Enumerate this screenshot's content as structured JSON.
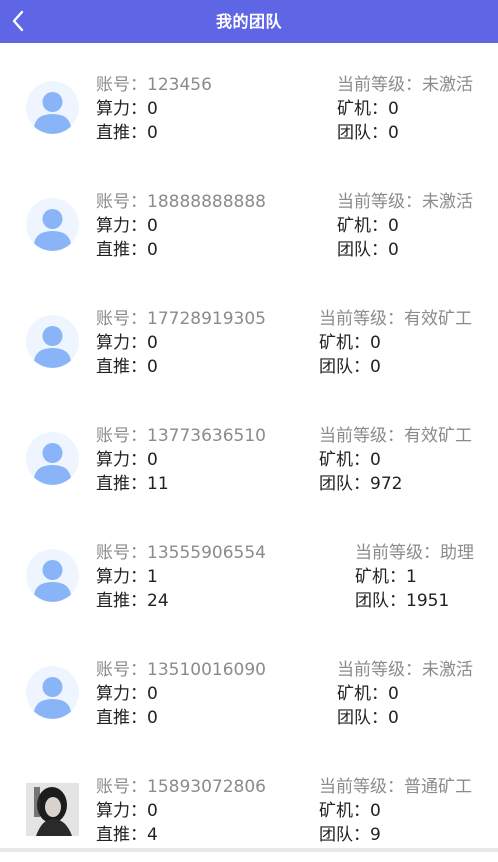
{
  "header": {
    "title": "我的团队",
    "back_icon": "chevron-left-icon",
    "background": "#5f66e6"
  },
  "labels": {
    "account": "账号：",
    "power": "算力：",
    "direct": "直推：",
    "level": "当前等级：",
    "miner": "矿机：",
    "team": "团队："
  },
  "members": [
    {
      "account": "123456",
      "power": "0",
      "direct": "0",
      "level": "未激活",
      "miner": "0",
      "team": "0",
      "avatar": "default-avatar"
    },
    {
      "account": "18888888888",
      "power": "0",
      "direct": "0",
      "level": "未激活",
      "miner": "0",
      "team": "0",
      "avatar": "default-avatar"
    },
    {
      "account": "17728919305",
      "power": "0",
      "direct": "0",
      "level": "有效矿工",
      "miner": "0",
      "team": "0",
      "avatar": "default-avatar"
    },
    {
      "account": "13773636510",
      "power": "0",
      "direct": "11",
      "level": "有效矿工",
      "miner": "0",
      "team": "972",
      "avatar": "default-avatar"
    },
    {
      "account": "13555906554",
      "power": "1",
      "direct": "24",
      "level": "助理",
      "miner": "1",
      "team": "1951",
      "avatar": "default-avatar"
    },
    {
      "account": "13510016090",
      "power": "0",
      "direct": "0",
      "level": "未激活",
      "miner": "0",
      "team": "0",
      "avatar": "default-avatar"
    },
    {
      "account": "15893072806",
      "power": "0",
      "direct": "4",
      "level": "普通矿工",
      "miner": "0",
      "team": "9",
      "avatar": "photo-avatar"
    }
  ]
}
